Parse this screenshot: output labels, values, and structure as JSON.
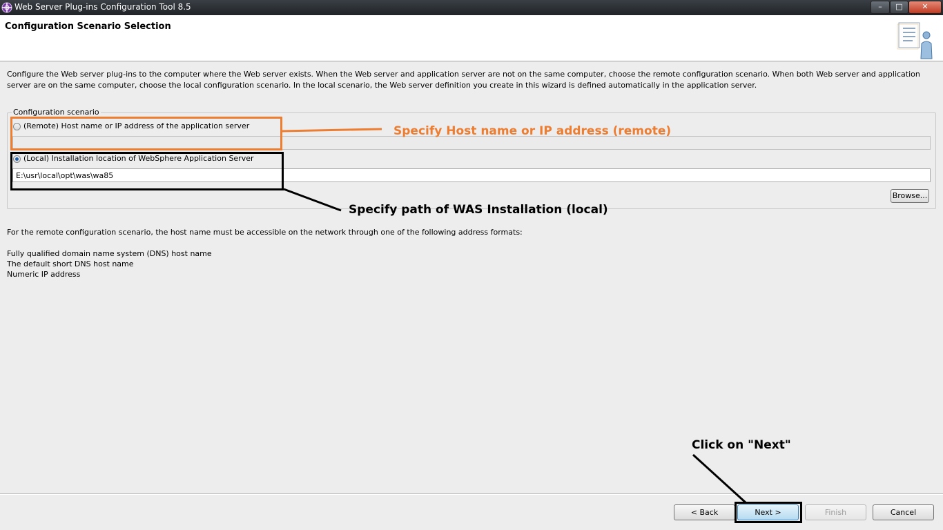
{
  "window": {
    "title": "Web Server Plug-ins Configuration Tool 8.5",
    "controls": {
      "minimize": "–",
      "maximize": "□",
      "close": "✕"
    }
  },
  "header": {
    "title": "Configuration Scenario Selection",
    "icon": "wizard-document-person-icon"
  },
  "description": "Configure the Web server plug-ins to the computer where the Web server exists. When the Web server and application server are not on the same computer, choose the remote configuration scenario. When both Web server and application server are on the same computer, choose the local configuration scenario. In the local scenario, the Web server definition you create in this wizard is defined automatically in the application server.",
  "scenario": {
    "legend": "Configuration scenario",
    "remote": {
      "label": "(Remote) Host name or IP address of the application server",
      "value": "",
      "selected": false
    },
    "local": {
      "label": "(Local) Installation location of WebSphere Application Server",
      "value": "E:\\usr\\local\\opt\\was\\wa85",
      "selected": true
    },
    "browse_label": "Browse..."
  },
  "note": "For the remote configuration scenario, the host name must be accessible on the network through one of the following address formats:",
  "formats": [
    "Fully qualified domain name system (DNS) host name",
    "The default short DNS host name",
    "Numeric IP address"
  ],
  "footer": {
    "back": "< Back",
    "next": "Next >",
    "finish": "Finish",
    "cancel": "Cancel"
  },
  "annotations": {
    "remote": "Specify Host name or IP address (remote)",
    "local": "Specify path of WAS Installation (local)",
    "next": "Click on \"Next\""
  },
  "colors": {
    "annotation_orange": "#ed7d31",
    "annotation_black": "#000000",
    "default_button": "#b6dbf1"
  }
}
